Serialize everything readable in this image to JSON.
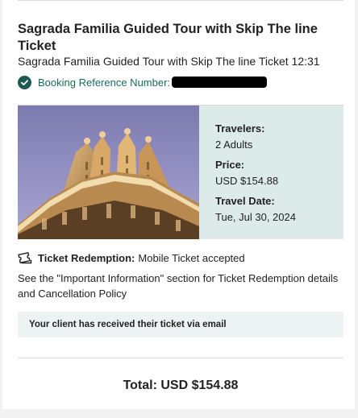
{
  "booking": {
    "title": "Sagrada Familia Guided Tour with Skip The line Ticket",
    "subtitle": "Sagrada Familia Guided Tour with Skip The line Ticket 12:31",
    "reference_label": "Booking Reference Number:",
    "image_alt": "Sagrada Familia towers"
  },
  "details": {
    "travelers_label": "Travelers:",
    "travelers_value": "2 Adults",
    "price_label": "Price:",
    "price_value": "USD $154.88",
    "date_label": "Travel Date:",
    "date_value": "Tue, Jul 30, 2024"
  },
  "redemption": {
    "label": "Ticket Redemption:",
    "value": "Mobile Ticket accepted",
    "info": "See the \"Important Information\" section for Ticket Redemption details and Cancellation Policy"
  },
  "notice": {
    "email_message": "Your client has received their ticket via email"
  },
  "summary": {
    "total": "Total: USD $154.88"
  },
  "icons": {
    "check": "check-circle-icon",
    "ticket": "ticket-icon"
  },
  "colors": {
    "accent": "#1a6b5a",
    "details_bg": "#dceaea",
    "notice_bg": "#edf3f3"
  }
}
